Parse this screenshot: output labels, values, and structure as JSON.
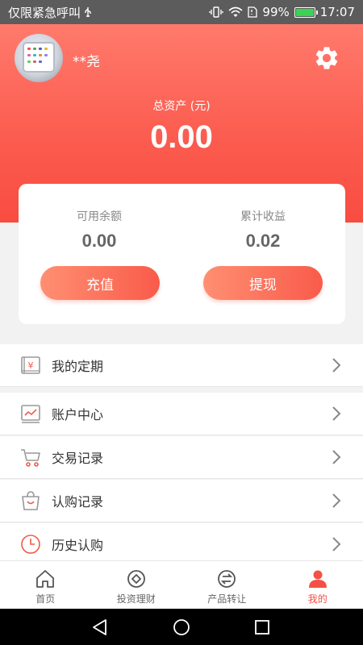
{
  "status_bar": {
    "left_text": "仅限紧急呼叫",
    "usb_icon": "usb-icon",
    "battery_percent": "99%",
    "battery_level": 0.99,
    "time": "17:07"
  },
  "header": {
    "username": "**尧",
    "total_assets_label": "总资产 (元)",
    "total_assets_value": "0.00",
    "gradient_top": "#ff7a6c",
    "gradient_bottom": "#f94c41"
  },
  "card": {
    "available_balance_label": "可用余额",
    "available_balance_value": "0.00",
    "cumulative_earnings_label": "累计收益",
    "cumulative_earnings_value": "0.02",
    "recharge_label": "充值",
    "withdraw_label": "提现"
  },
  "menu": {
    "items": [
      {
        "label": "我的定期",
        "icon": "fixed-term-icon"
      },
      {
        "label": "账户中心",
        "icon": "account-chart-icon"
      },
      {
        "label": "交易记录",
        "icon": "cart-icon"
      },
      {
        "label": "认购记录",
        "icon": "shopping-bag-icon"
      },
      {
        "label": "历史认购",
        "icon": "clock-icon"
      }
    ]
  },
  "bottom_nav": {
    "items": [
      {
        "label": "首页",
        "icon": "home-icon"
      },
      {
        "label": "投资理财",
        "icon": "invest-icon"
      },
      {
        "label": "产品转让",
        "icon": "transfer-icon"
      },
      {
        "label": "我的",
        "icon": "profile-icon"
      }
    ],
    "active_index": 3,
    "active_color": "#f45045"
  },
  "accent_color": "#fb5b4e"
}
